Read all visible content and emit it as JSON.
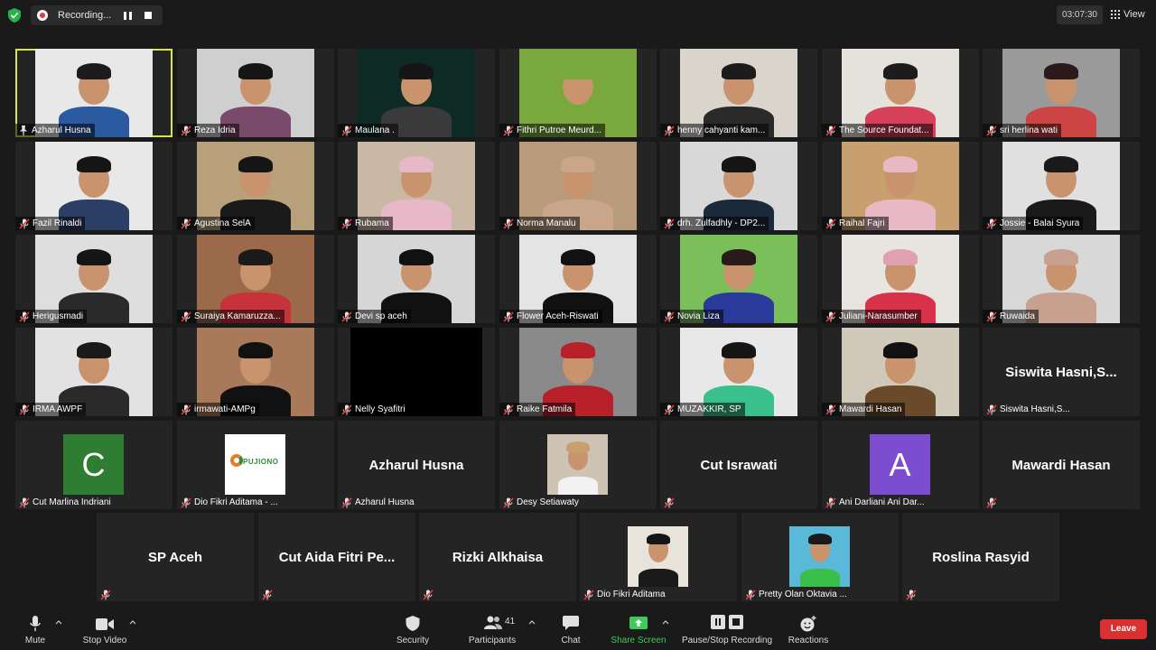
{
  "recording": {
    "label": "Recording..."
  },
  "timer": "03:07:30",
  "view": {
    "label": "View"
  },
  "participants": [
    {
      "name": "Azharul Husna",
      "video": true,
      "pinned": true,
      "active": true,
      "bg": "#e8e8e8",
      "shirt": "#2c5aa0",
      "hair": "#1c1c1c"
    },
    {
      "name": "Reza Idria",
      "video": true,
      "bg": "#cfcfcf",
      "shirt": "#7a4a6a",
      "hair": "#151515"
    },
    {
      "name": "Maulana .",
      "video": true,
      "bg": "#0d2b24",
      "shirt": "#3a3a3a",
      "hair": "#151515"
    },
    {
      "name": "Fithri Putroe Meurd...",
      "video": true,
      "bg": "#79a83d",
      "shirt": "#79a83d",
      "hair": "#79a83d"
    },
    {
      "name": "henny cahyanti kam...",
      "video": true,
      "bg": "#d9d5cc",
      "shirt": "#2a2a2a",
      "hair": "#1c1c1c"
    },
    {
      "name": "The Source Foundat...",
      "video": true,
      "bg": "#e5e2dc",
      "shirt": "#d6405a",
      "hair": "#1c1c1c"
    },
    {
      "name": "sri herlina wati",
      "video": true,
      "bg": "#9a9a9a",
      "shirt": "#c44",
      "hair": "#2a1a1a"
    },
    {
      "name": "Fazil Rinaldi",
      "video": true,
      "bg": "#e8e8e8",
      "shirt": "#2b3e66",
      "hair": "#151515"
    },
    {
      "name": "Agustina SelA",
      "video": true,
      "bg": "#b7a07a",
      "shirt": "#1a1a1a",
      "hair": "#151515"
    },
    {
      "name": "Rubama",
      "video": true,
      "bg": "#c9b9a4",
      "shirt": "#e7b8c8",
      "hair": "#e7b8c8"
    },
    {
      "name": "Norma Manalu",
      "video": true,
      "bg": "#b89b7a",
      "shirt": "#c9a58a",
      "hair": "#c9a58a"
    },
    {
      "name": "drh. Zulfadhly - DP2...",
      "video": true,
      "bg": "#d8d8d8",
      "shirt": "#1a2a3a",
      "hair": "#151515"
    },
    {
      "name": "Raihal Fajri",
      "video": true,
      "bg": "#c8a070",
      "shirt": "#e8b8c4",
      "hair": "#e8b8c4"
    },
    {
      "name": "Jossie - Balai Syura",
      "video": true,
      "bg": "#e0e0e0",
      "shirt": "#1a1a1a",
      "hair": "#1a1a1a"
    },
    {
      "name": "Herigusmadi",
      "video": true,
      "bg": "#dedede",
      "shirt": "#2a2a2a",
      "hair": "#151515"
    },
    {
      "name": "Suraiya Kamaruzza...",
      "video": true,
      "bg": "#9a6a4a",
      "shirt": "#c8323a",
      "hair": "#1a1a1a"
    },
    {
      "name": "Devi sp aceh",
      "video": true,
      "bg": "#d6d6d6",
      "shirt": "#111",
      "hair": "#111"
    },
    {
      "name": "Flower Aceh-Riswati",
      "video": true,
      "bg": "#e4e4e4",
      "shirt": "#111",
      "hair": "#111"
    },
    {
      "name": "Novia Liza",
      "video": true,
      "bg": "#7abf5a",
      "shirt": "#2a3a9a",
      "hair": "#2a1a1a"
    },
    {
      "name": "Juliani-Narasumber",
      "video": true,
      "bg": "#e8e4e0",
      "shirt": "#d8324a",
      "hair": "#e0a0b0"
    },
    {
      "name": "Ruwaida",
      "video": true,
      "bg": "#d8d8d8",
      "shirt": "#c8a090",
      "hair": "#c8a090"
    },
    {
      "name": "IRMA AWPF",
      "video": true,
      "bg": "#e2e2e2",
      "shirt": "#2a2a2a",
      "hair": "#1a1a1a"
    },
    {
      "name": "irmawati-AMPg",
      "video": true,
      "bg": "#a87a5a",
      "shirt": "#111",
      "hair": "#111"
    },
    {
      "name": "Nelly Syafitri",
      "video": true,
      "black": true,
      "bg": "#000",
      "shirt": "#000",
      "hair": "#000"
    },
    {
      "name": "Raike Fatmila",
      "video": true,
      "bg": "#8a8a8a",
      "shirt": "#b8202a",
      "hair": "#b8202a"
    },
    {
      "name": "MUZAKKIR, SP",
      "video": true,
      "bg": "#e8e8e8",
      "shirt": "#3ac08a",
      "hair": "#151515"
    },
    {
      "name": "Mawardi Hasan",
      "video": true,
      "bg": "#d0c8b8",
      "shirt": "#6a4a2a",
      "hair": "#111"
    },
    {
      "name": "Siswita Hasni,S...",
      "video": false,
      "big": "Siswita  Hasni,S..."
    },
    {
      "name": "Cut Marlina Indriani",
      "video": false,
      "letter": "C",
      "letterColor": "#2e7d32"
    },
    {
      "name": "Dio Fikri Aditama - ...",
      "video": false,
      "logo": "PUJIONO"
    },
    {
      "name": "Azharul Husna",
      "video": false,
      "big": "Azharul Husna"
    },
    {
      "name": "Desy Setiawaty",
      "video": false,
      "photo": true,
      "bg": "#cfc4b4",
      "shirt": "#f2f2f2",
      "hair": "#c8a070"
    },
    {
      "name": "",
      "video": false,
      "big": "Cut Israwati"
    },
    {
      "name": "Ani Darliani Ani Dar...",
      "video": false,
      "letter": "A",
      "letterColor": "#7c4dce"
    },
    {
      "name": "",
      "video": false,
      "big": "Mawardi Hasan"
    },
    {
      "name": "",
      "video": false,
      "big": "SP Aceh"
    },
    {
      "name": "",
      "video": false,
      "big": "Cut Aida Fitri Pe..."
    },
    {
      "name": "",
      "video": false,
      "big": "Rizki Alkhaisa"
    },
    {
      "name": "Dio Fikri Aditama",
      "video": false,
      "photo": true,
      "bg": "#e8e4dc",
      "shirt": "#1a1a1a",
      "hair": "#151515"
    },
    {
      "name": "Pretty Olan Oktavia ...",
      "video": false,
      "photo": true,
      "bg": "#5ab8d8",
      "shirt": "#3ac04a",
      "hair": "#1a1a1a"
    },
    {
      "name": "",
      "video": false,
      "big": "Roslina Rasyid"
    }
  ],
  "toolbar": {
    "mute": "Mute",
    "stop_video": "Stop Video",
    "security": "Security",
    "participants": "Participants",
    "participants_count": "41",
    "chat": "Chat",
    "share_screen": "Share Screen",
    "pause_stop_recording": "Pause/Stop Recording",
    "reactions": "Reactions",
    "leave": "Leave"
  },
  "colors": {
    "share_green": "#3fcb5a",
    "leave_red": "#d93131",
    "active_border": "#d7e44c"
  }
}
